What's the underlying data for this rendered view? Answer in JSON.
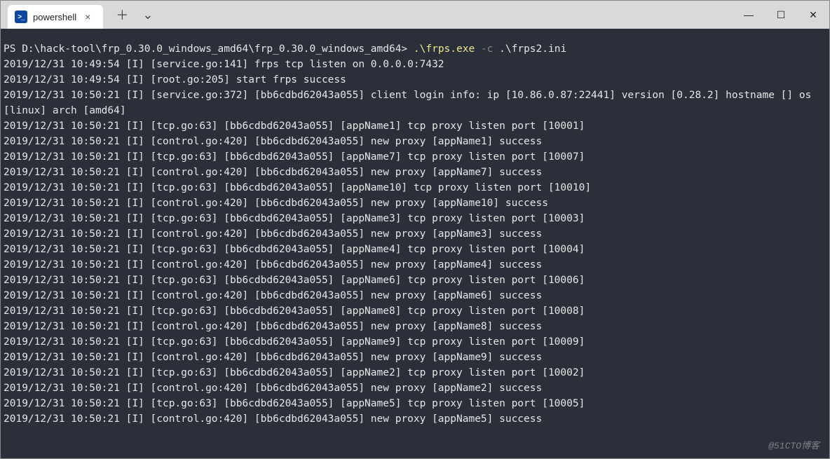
{
  "titlebar": {
    "tab_label": "powershell",
    "new_tab_glyph": "＋",
    "dropdown_glyph": "⌄",
    "close_glyph": "×",
    "minimize_glyph": "—",
    "maximize_glyph": "☐",
    "window_close_glyph": "✕"
  },
  "prompt": {
    "path": "PS D:\\hack-tool\\frp_0.30.0_windows_amd64\\frp_0.30.0_windows_amd64>",
    "exe": ".\\frps.exe",
    "flag": "-c",
    "arg": ".\\frps2.ini"
  },
  "log_lines": [
    "2019/12/31 10:49:54 [I] [service.go:141] frps tcp listen on 0.0.0.0:7432",
    "2019/12/31 10:49:54 [I] [root.go:205] start frps success",
    "2019/12/31 10:50:21 [I] [service.go:372] [bb6cdbd62043a055] client login info: ip [10.86.0.87:22441] version [0.28.2] hostname [] os [linux] arch [amd64]",
    "2019/12/31 10:50:21 [I] [tcp.go:63] [bb6cdbd62043a055] [appName1] tcp proxy listen port [10001]",
    "2019/12/31 10:50:21 [I] [control.go:420] [bb6cdbd62043a055] new proxy [appName1] success",
    "2019/12/31 10:50:21 [I] [tcp.go:63] [bb6cdbd62043a055] [appName7] tcp proxy listen port [10007]",
    "2019/12/31 10:50:21 [I] [control.go:420] [bb6cdbd62043a055] new proxy [appName7] success",
    "2019/12/31 10:50:21 [I] [tcp.go:63] [bb6cdbd62043a055] [appName10] tcp proxy listen port [10010]",
    "2019/12/31 10:50:21 [I] [control.go:420] [bb6cdbd62043a055] new proxy [appName10] success",
    "2019/12/31 10:50:21 [I] [tcp.go:63] [bb6cdbd62043a055] [appName3] tcp proxy listen port [10003]",
    "2019/12/31 10:50:21 [I] [control.go:420] [bb6cdbd62043a055] new proxy [appName3] success",
    "2019/12/31 10:50:21 [I] [tcp.go:63] [bb6cdbd62043a055] [appName4] tcp proxy listen port [10004]",
    "2019/12/31 10:50:21 [I] [control.go:420] [bb6cdbd62043a055] new proxy [appName4] success",
    "2019/12/31 10:50:21 [I] [tcp.go:63] [bb6cdbd62043a055] [appName6] tcp proxy listen port [10006]",
    "2019/12/31 10:50:21 [I] [control.go:420] [bb6cdbd62043a055] new proxy [appName6] success",
    "2019/12/31 10:50:21 [I] [tcp.go:63] [bb6cdbd62043a055] [appName8] tcp proxy listen port [10008]",
    "2019/12/31 10:50:21 [I] [control.go:420] [bb6cdbd62043a055] new proxy [appName8] success",
    "2019/12/31 10:50:21 [I] [tcp.go:63] [bb6cdbd62043a055] [appName9] tcp proxy listen port [10009]",
    "2019/12/31 10:50:21 [I] [control.go:420] [bb6cdbd62043a055] new proxy [appName9] success",
    "2019/12/31 10:50:21 [I] [tcp.go:63] [bb6cdbd62043a055] [appName2] tcp proxy listen port [10002]",
    "2019/12/31 10:50:21 [I] [control.go:420] [bb6cdbd62043a055] new proxy [appName2] success",
    "2019/12/31 10:50:21 [I] [tcp.go:63] [bb6cdbd62043a055] [appName5] tcp proxy listen port [10005]",
    "2019/12/31 10:50:21 [I] [control.go:420] [bb6cdbd62043a055] new proxy [appName5] success"
  ],
  "watermark": "@51CTO博客"
}
